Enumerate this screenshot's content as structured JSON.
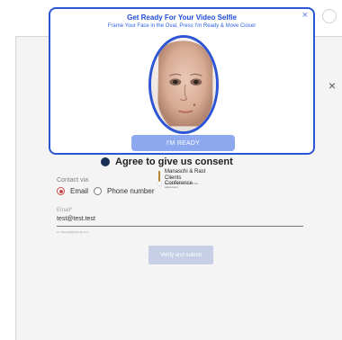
{
  "modal": {
    "title": "Get Ready For Your Video Selfie",
    "subtitle": "Frame Your Face in the Oval, Press I'm Ready & Move Closer",
    "ready_button": "I'M READY",
    "close_glyph": "×"
  },
  "background": {
    "close_glyph": "×",
    "consent_text": "Agree to give us consent",
    "logo": {
      "line1": "Manaschi & Rast",
      "line2": "Clients Conference",
      "fine_print": "Powered by AI flow with fine adjustment"
    },
    "contact_label": "Contact via",
    "contact_options": [
      {
        "label": "Email",
        "selected": true
      },
      {
        "label": "Phone number",
        "selected": false
      }
    ],
    "email": {
      "label": "Email*",
      "value": "test@test.test",
      "hint": "ex: thatmail@thatmail.com"
    },
    "verify_button": "Verify and submit"
  },
  "colors": {
    "modal_accent": "#2b55d4",
    "ready_button": "#8ea8ef",
    "radio_selected": "#c74949",
    "consent_bullet": "#1a2f55"
  },
  "icons": {
    "modal_close": "close-icon",
    "background_close": "close-icon",
    "logo": "logo-mark-icon",
    "topbar": "user-avatar-icon"
  }
}
